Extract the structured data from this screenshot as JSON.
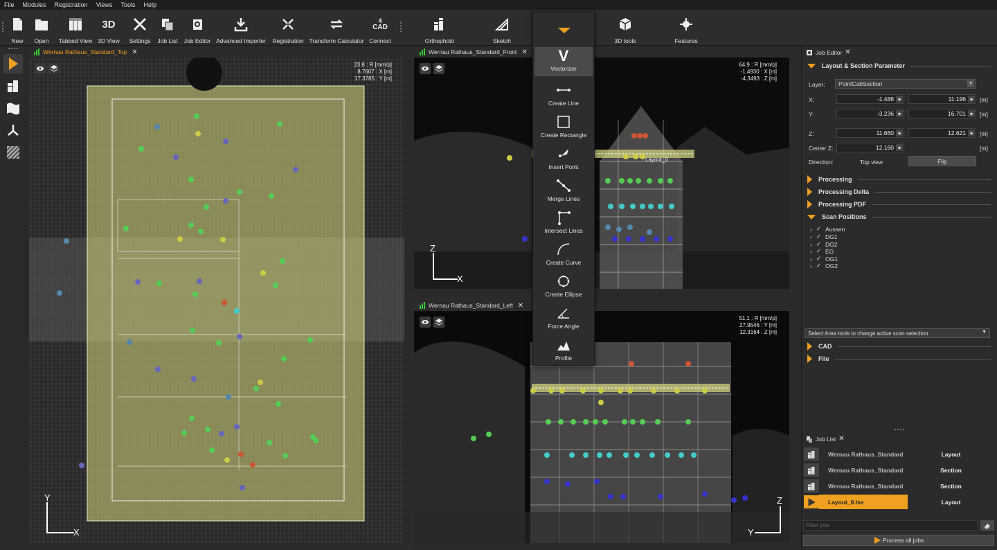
{
  "menu": [
    "File",
    "Modules",
    "Registration",
    "Views",
    "Tools",
    "Help"
  ],
  "toolbar": [
    {
      "label": "New",
      "icon": "new-icon"
    },
    {
      "label": "Open",
      "icon": "folder-icon"
    },
    {
      "label": "Tabbed View",
      "icon": "tabbed-view-icon"
    },
    {
      "label": "3D View",
      "icon": "3d-text-icon"
    },
    {
      "label": "Settings",
      "icon": "settings-tools-icon"
    },
    {
      "label": "Job List",
      "icon": "job-list-icon"
    },
    {
      "label": "Job Editor",
      "icon": "job-editor-icon"
    },
    {
      "label": "Advanced Importer",
      "icon": "download-icon"
    },
    {
      "label": "Registration",
      "icon": "registration-icon"
    },
    {
      "label": "Transform Calculator",
      "icon": "transform-icon"
    },
    {
      "label": "Connect",
      "icon": "cad-connect-icon"
    },
    {
      "label": "Orthophoto",
      "icon": "orthophoto-icon"
    },
    {
      "label": "Sketch",
      "icon": "sketch-icon"
    },
    {
      "label": "3D tools",
      "icon": "cube-icon"
    },
    {
      "label": "Features",
      "icon": "features-icon"
    }
  ],
  "toolbar_text": {
    "3d": "3D",
    "cad_num": "4",
    "cad": "CAD"
  },
  "viewports": {
    "top": {
      "title": "Wernau Rathaus_Standard_Top",
      "info": [
        "23.8 : R [mm/p]",
        "8.7607 : X [m]",
        "17.3785 : Y [m]"
      ],
      "axis_v": "Y",
      "axis_h": "X"
    },
    "front": {
      "title": "Wernau Rathaus_Standard_Front",
      "info": [
        "64.9 : R [mm/p]",
        "-1.4930 : X [m]",
        "-4.3493 : Z [m]"
      ],
      "axis_v": "Z",
      "axis_h": "X",
      "layout_label": "Layout_0"
    },
    "left": {
      "title": "Wernau Rathaus_Standard_Left",
      "info": [
        "51.1 : R [mm/p]",
        "27.9546 : Y [m]",
        "12.3164 : Z [m]"
      ],
      "axis_v": "Z",
      "axis_h": "Y"
    }
  },
  "dropdown": {
    "header": "Vectorizer",
    "items": [
      "Create Line",
      "Create Rectangle",
      "Insert Point",
      "Merge Lines",
      "Intersect Lines",
      "Create Curve",
      "Create Ellipse",
      "Force Angle",
      "Profile"
    ]
  },
  "job_editor": {
    "title": "Job Editor",
    "section": "Layout & Section Parameter",
    "layer_label": "Layer:",
    "layer_value": "PointCabSection",
    "x_label": "X:",
    "x_min": "-1.488",
    "x_max": "11.196",
    "y_label": "Y:",
    "y_min": "-3.236",
    "y_max": "16.701",
    "z_label": "Z:",
    "z_min": "11.660",
    "z_max": "12.621",
    "unit": "[m]",
    "center_z_label": "Center Z:",
    "center_z": "12.160",
    "direction_label": "Direction:",
    "direction_value": "Top view",
    "flip": "Flip",
    "collapsed": [
      "Processing",
      "Processing Delta",
      "Processing PDF"
    ],
    "scan_positions": "Scan Positions",
    "scans": [
      "Aussen",
      "DG1",
      "DG2",
      "EG",
      "OG1",
      "OG2"
    ],
    "check": "✓",
    "area_select": "Select Area tools to change active scan selection",
    "cad": "CAD",
    "file": "File"
  },
  "job_list": {
    "title": "Job List",
    "jobs": [
      {
        "name": "Wernau Rathaus_Standard",
        "type": "Layout",
        "active": false
      },
      {
        "name": "Wernau Rathaus_Standard",
        "type": "Section",
        "active": false
      },
      {
        "name": "Wernau Rathaus_Standard",
        "type": "Section",
        "active": false
      },
      {
        "name": "Layout_0.lse",
        "type": "Layout",
        "active": true
      }
    ],
    "filter_placeholder": "Filter jobs",
    "process_all": "Process all jobs"
  },
  "colors": {
    "accent": "#f0a020",
    "selection": "#d8d880",
    "panel": "#2b2b2b"
  }
}
